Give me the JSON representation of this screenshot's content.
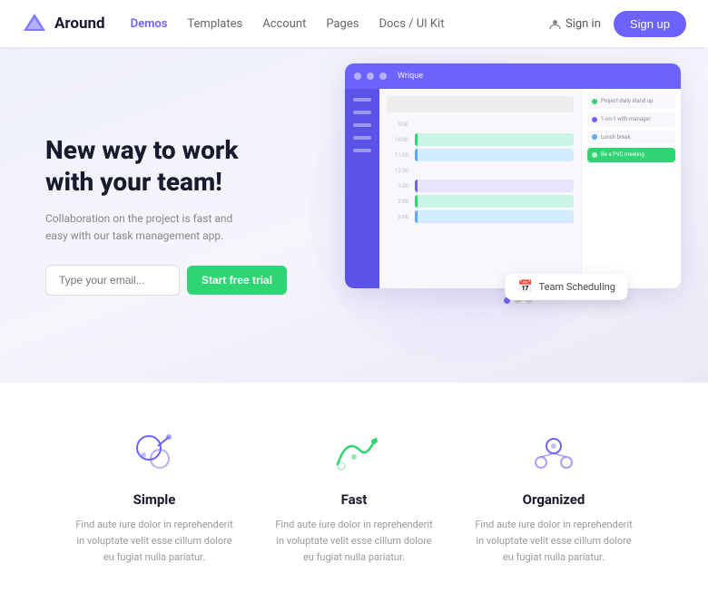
{
  "navbar": {
    "logo_text": "Around",
    "links": [
      {
        "label": "Demos",
        "active": true
      },
      {
        "label": "Templates",
        "active": false
      },
      {
        "label": "Account",
        "active": false
      },
      {
        "label": "Pages",
        "active": false
      },
      {
        "label": "Docs / UI Kit",
        "active": false
      }
    ],
    "sign_in_label": "Sign in",
    "sign_up_label": "Sign up"
  },
  "hero": {
    "title": "New way to work with your team!",
    "subtitle": "Collaboration on the project is fast and easy with our task management app.",
    "email_placeholder": "Type your email...",
    "cta_label": "Start free trial",
    "mockup": {
      "titlebar_title": "Wrique",
      "calendar_times": [
        "9:00",
        "10:00",
        "11:00",
        "12:00",
        "1:00",
        "2:00"
      ],
      "tooltip_label": "Team Scheduling"
    }
  },
  "pagination": {
    "dots": [
      {
        "active": true
      },
      {
        "active": false
      },
      {
        "active": false
      }
    ]
  },
  "features": [
    {
      "id": "simple",
      "title": "Simple",
      "desc": "Find aute iure dolor in reprehenderit in voluptate velit esse cillum dolore eu fugiat nulla pariatur.",
      "icon_color": "#6c63ff"
    },
    {
      "id": "fast",
      "title": "Fast",
      "desc": "Find aute iure dolor in reprehenderit in voluptate velit esse cillum dolore eu fugiat nulla pariatur.",
      "icon_color": "#2ed573"
    },
    {
      "id": "organized",
      "title": "Organized",
      "desc": "Find aute iure dolor in reprehenderit in voluptate velit esse cillum dolore eu fugiat nulla pariatur.",
      "icon_color": "#6c63ff"
    }
  ],
  "colors": {
    "primary": "#6c63ff",
    "cta": "#2ed573",
    "text_dark": "#1a1a2e",
    "text_muted": "#999"
  }
}
